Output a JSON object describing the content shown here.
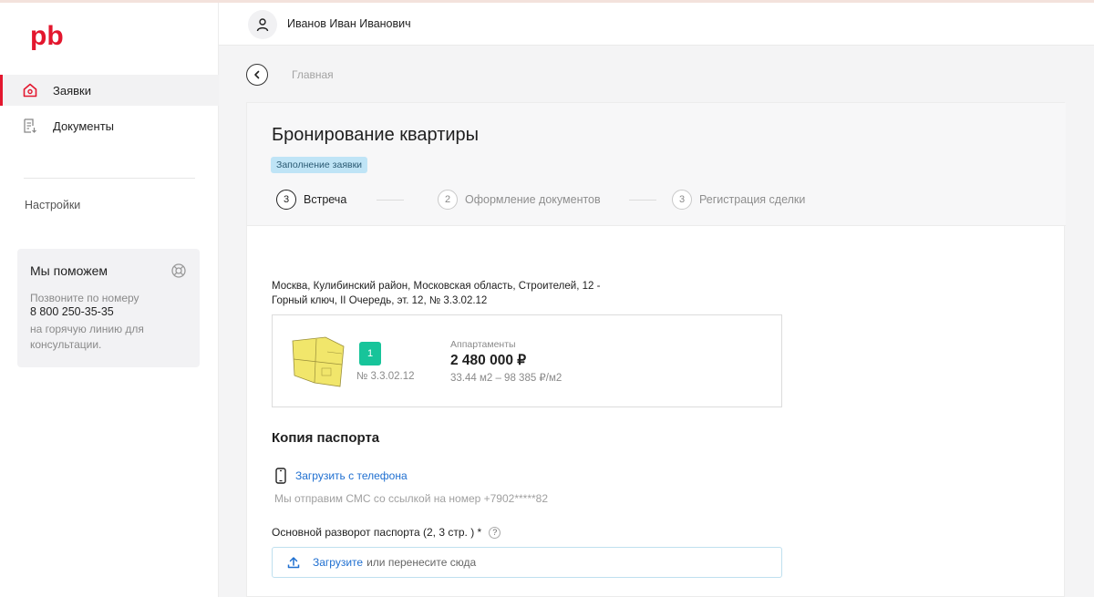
{
  "brand": {
    "logo_text": "pb",
    "accent": "#e3172e"
  },
  "sidebar": {
    "items": [
      {
        "label": "Заявки",
        "icon": "home-icon",
        "active": true
      },
      {
        "label": "Документы",
        "icon": "document-icon",
        "active": false
      }
    ],
    "settings_label": "Настройки",
    "help": {
      "title": "Мы поможем",
      "icon": "lifebuoy-icon",
      "text_before": "Позвоните по номеру",
      "phone": "8 800 250-35-35",
      "text_after_1": "на горячую линию для",
      "text_after_2": "консультации."
    }
  },
  "header": {
    "user_name": "Иванов Иван Иванович",
    "avatar_icon": "user-icon"
  },
  "breadcrumb": {
    "back_icon": "chevron-left-icon",
    "home_label": "Главная"
  },
  "page": {
    "title": "Бронирование квартиры",
    "status_badge": "Заполнение заявки",
    "steps": [
      {
        "number": "3",
        "label": "Встреча",
        "active": true
      },
      {
        "number": "2",
        "label": "Оформление документов",
        "active": false
      },
      {
        "number": "3",
        "label": "Регистрация сделки",
        "active": false
      }
    ],
    "address_line1": "Москва, Кулибинский район, Московская область, Строителей, 12 -",
    "address_line2": "Горный ключ, II Очередь, эт. 12, № 3.3.02.12",
    "apartment": {
      "floor": "1",
      "number": "№ 3.3.02.12",
      "type": "Аппартаменты",
      "price": "2 480 000 ₽",
      "area": "33.44 м2 – 98 385 ₽/м2"
    },
    "passport": {
      "section_title": "Копия паспорта",
      "upload_phone_label": "Загрузить с телефона",
      "sms_note": "Мы отправим СМС со ссылкой на номер +7902*****82",
      "field_label": "Основной разворот паспорта (2, 3 стр. ) *",
      "help_mark": "?",
      "dropzone_link": "Загрузите",
      "dropzone_rest": "или перенесите сюда"
    }
  }
}
